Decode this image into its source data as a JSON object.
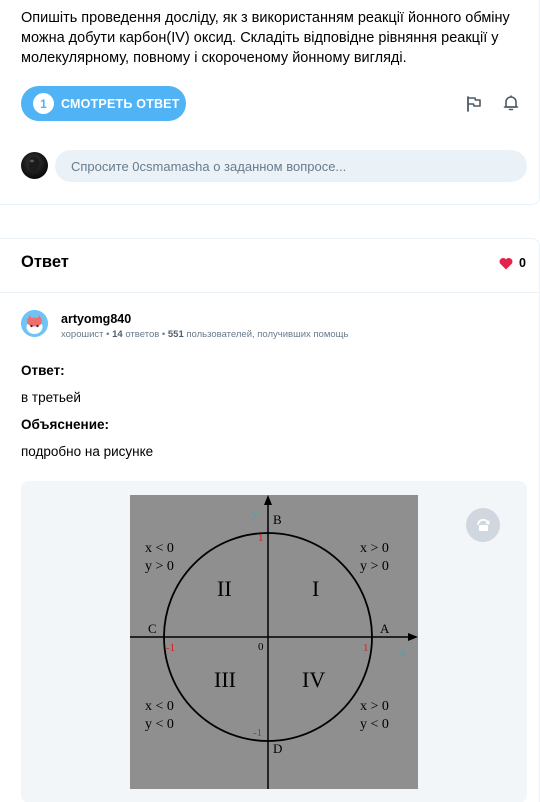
{
  "question": {
    "text": "Опишіть проведення досліду, як з використанням реакції йонного обміну можна добути карбон(IV) оксид. Складіть відповідне рівняння реакції у молекулярному, повному і скороченому йонному вигляді.",
    "answer_button": {
      "count": "1",
      "label": "СМОТРЕТЬ ОТВЕТ"
    },
    "ask_placeholder": "Спросите 0csmamasha о заданном вопросе..."
  },
  "answer": {
    "heading": "Ответ",
    "likes": "0",
    "user": {
      "name": "artyomg840",
      "rank": "хорошист",
      "answers_count": "14",
      "answers_label": "ответов",
      "helped_count": "551",
      "helped_label": "пользователей, получивших помощь"
    },
    "label_answer": "Ответ:",
    "answer_text": "в третьей",
    "label_explanation": "Объяснение:",
    "explanation_text": "подробно на рисунке"
  },
  "diagram": {
    "points": {
      "top": "B",
      "left": "C",
      "right": "A",
      "bottom": "D"
    },
    "ticks": {
      "top": "1",
      "left": "-1",
      "right": "1",
      "bottom": "-1",
      "origin": "0"
    },
    "axis_labels": {
      "y": "y",
      "x": "x"
    },
    "quadrants": {
      "q1": "I",
      "q2": "II",
      "q3": "III",
      "q4": "IV"
    },
    "conditions": {
      "q2_x": "x < 0",
      "q2_y": "y > 0",
      "q1_x": "x > 0",
      "q1_y": "y > 0",
      "q3_x": "x < 0",
      "q3_y": "y < 0",
      "q4_x": "x > 0",
      "q4_y": "y < 0"
    }
  },
  "colors": {
    "accent": "#4fb3f6",
    "heart": "#e6224a",
    "tick_red": "#d81e1e",
    "axis_label_teal": "#3fa7b4"
  }
}
